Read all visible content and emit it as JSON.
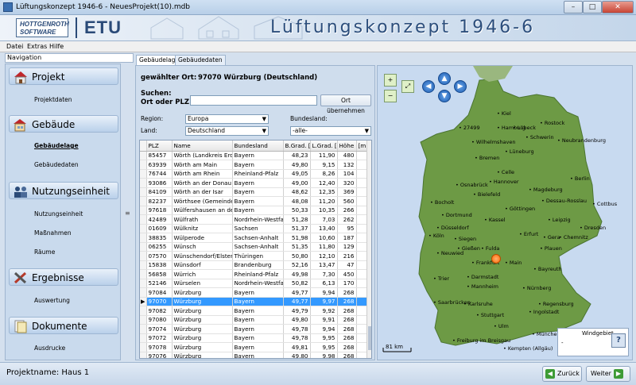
{
  "window": {
    "title": "Lüftungskonzept 1946-6  - NeuesProjekt(10).mdb",
    "min": "–",
    "max": "□",
    "close": "✕"
  },
  "banner": {
    "logo_line1": "HOTTGENROTH",
    "logo_line2": "SOFTWARE",
    "product": "ETU",
    "title": "Lüftungskonzept 1946-6"
  },
  "menu": {
    "datei": "Datei",
    "extras": "Extras",
    "hilfe": "Hilfe"
  },
  "navigation": {
    "header": "Navigation",
    "sections": [
      {
        "label": "Projekt",
        "items": [
          "Projektdaten"
        ]
      },
      {
        "label": "Gebäude",
        "items": [
          "Gebäudelage",
          "Gebäudedaten"
        ]
      },
      {
        "label": "Nutzungseinheit",
        "items": [
          "Nutzungseinheit",
          "Maßnahmen",
          "Räume"
        ]
      },
      {
        "label": "Ergebnisse",
        "items": [
          "Auswertung"
        ]
      },
      {
        "label": "Dokumente",
        "items": [
          "Ausdrucke"
        ]
      }
    ],
    "active_item": "Gebäudelage"
  },
  "tabs": [
    "Gebäudelage",
    "Gebäudedaten"
  ],
  "location": {
    "selected_label": "gewählter Ort:",
    "selected_value": "97070 Würzburg (Deutschland)",
    "search_label1": "Suchen:",
    "search_label2": "Ort oder PLZ:",
    "search_value": "",
    "apply_button": "Ort übernehmen",
    "region_label": "Region:",
    "region_value": "Europa",
    "land_label": "Land:",
    "land_value": "Deutschland",
    "bundesland_label": "Bundesland:",
    "bundesland_value": "-alle-"
  },
  "table": {
    "columns": [
      "PLZ",
      "Name",
      "Bundesland",
      "B.Grad. [",
      "L.Grad. [",
      "Höhe",
      "[m"
    ],
    "rows": [
      [
        "85457",
        "Wörth (Landkreis Erding)",
        "Bayern",
        "48,23",
        "11,90",
        "480"
      ],
      [
        "63939",
        "Wörth am Main",
        "Bayern",
        "49,80",
        "9,15",
        "132"
      ],
      [
        "76744",
        "Wörth am Rhein",
        "Rheinland-Pfalz",
        "49,05",
        "8,26",
        "104"
      ],
      [
        "93086",
        "Wörth an der Donau",
        "Bayern",
        "49,00",
        "12,40",
        "320"
      ],
      [
        "84109",
        "Wörth an der Isar",
        "Bayern",
        "48,62",
        "12,35",
        "369"
      ],
      [
        "82237",
        "Wörthsee (Gemeinde)",
        "Bayern",
        "48,08",
        "11,20",
        "560"
      ],
      [
        "97618",
        "Wülfershausen an der Saale",
        "Bayern",
        "50,33",
        "10,35",
        "266"
      ],
      [
        "42489",
        "Wülfrath",
        "Nordrhein-Westfalen",
        "51,28",
        "7,03",
        "262"
      ],
      [
        "01609",
        "Wülknitz",
        "Sachsen",
        "51,37",
        "13,40",
        "95"
      ],
      [
        "38835",
        "Wülperode",
        "Sachsen-Anhalt",
        "51,98",
        "10,60",
        "187"
      ],
      [
        "06255",
        "Wünsch",
        "Sachsen-Anhalt",
        "51,35",
        "11,80",
        "129"
      ],
      [
        "07570",
        "Wünschendorf/Elster",
        "Thüringen",
        "50,80",
        "12,10",
        "216"
      ],
      [
        "15838",
        "Wünsdorf",
        "Brandenburg",
        "52,16",
        "13,47",
        "47"
      ],
      [
        "56858",
        "Würrich",
        "Rheinland-Pfalz",
        "49,98",
        "7,30",
        "450"
      ],
      [
        "52146",
        "Würselen",
        "Nordrhein-Westfalen",
        "50,82",
        "6,13",
        "170"
      ],
      [
        "97084",
        "Würzburg",
        "Bayern",
        "49,77",
        "9,94",
        "268"
      ],
      [
        "97070",
        "Würzburg",
        "Bayern",
        "49,77",
        "9,97",
        "268"
      ],
      [
        "97082",
        "Würzburg",
        "Bayern",
        "49,79",
        "9,92",
        "268"
      ],
      [
        "97080",
        "Würzburg",
        "Bayern",
        "49,80",
        "9,91",
        "268"
      ],
      [
        "97074",
        "Würzburg",
        "Bayern",
        "49,78",
        "9,94",
        "268"
      ],
      [
        "97072",
        "Würzburg",
        "Bayern",
        "49,78",
        "9,95",
        "268"
      ],
      [
        "97078",
        "Würzburg",
        "Bayern",
        "49,81",
        "9,95",
        "268"
      ],
      [
        "97076",
        "Würzburg",
        "Bayern",
        "49,80",
        "9,98",
        "268"
      ]
    ],
    "selected_index": 16
  },
  "map": {
    "cities": [
      "Kiel",
      "Rostock",
      "Hamburg",
      "Lübeck",
      "Wilhelmshaven",
      "Schwerin",
      "Neubrandenburg",
      "Bremen",
      "Lüneburg",
      "Berlin",
      "Celle",
      "Osnabrück",
      "Hannover",
      "Magdeburg",
      "Bielefeld",
      "Dessau-Rosslau",
      "Cottbus",
      "Bocholt",
      "Göttingen",
      "Dortmund",
      "Kassel",
      "Leipzig",
      "Düsseldorf",
      "Köln",
      "Siegen",
      "Gera",
      "Chemnitz",
      "Dresden",
      "Erfurt",
      "Gießen",
      "Fulda",
      "Neuwied",
      "Plauen",
      "Frankfurt",
      "Main",
      "Trier",
      "Darmstadt",
      "Bayreuth",
      "Mannheim",
      "Nürnberg",
      "Saarbrücken",
      "Karlsruhe",
      "Regensburg",
      "Stuttgart",
      "Ingolstadt",
      "Ulm",
      "Freiburg im Breisgau",
      "München",
      "Kempten (Allgäu)"
    ],
    "city_27499": "27499",
    "scale": "81 km",
    "wind_label": "Windgebiet",
    "wind_value": "-",
    "help": "?",
    "marker_color": "#ff6a00"
  },
  "footer": {
    "project_name": "Projektname: Haus 1",
    "back_button": "Zurück",
    "next_button": "Weiter"
  }
}
